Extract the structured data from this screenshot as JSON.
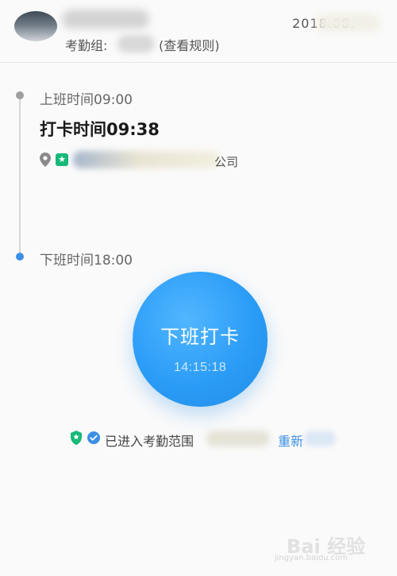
{
  "header": {
    "date": "2018.08.",
    "group_prefix": "考勤组:",
    "rules_link": "(查看规则)"
  },
  "timeline": {
    "start_label": "上班时间09:00",
    "checkin_label": "打卡时间09:38",
    "location_suffix": "公司",
    "end_label": "下班时间18:00"
  },
  "punch": {
    "title": "下班打卡",
    "time": "14:15:18"
  },
  "status": {
    "text": "已进入考勤范围",
    "refresh_label": "重新"
  },
  "watermark": {
    "text": "Bai 经验",
    "sub": "jingyan.baidu.com"
  },
  "colors": {
    "accent": "#2b9cf7",
    "link": "#3d8fe6",
    "badge": "#17b978"
  }
}
